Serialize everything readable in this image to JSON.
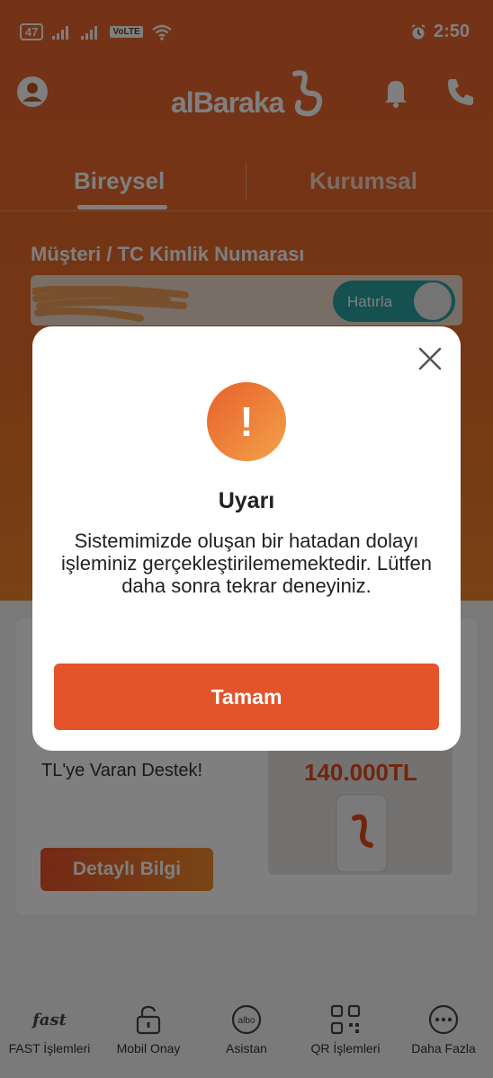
{
  "status_bar": {
    "battery": "47",
    "network_tag": "VoLTE",
    "time": "2:50"
  },
  "header": {
    "logo_text": "alBaraka",
    "icons": [
      "profile-icon",
      "bell-icon",
      "phone-icon"
    ]
  },
  "tabs": [
    {
      "label": "Bireysel",
      "active": true
    },
    {
      "label": "Kurumsal",
      "active": false
    }
  ],
  "login": {
    "field_label": "Müşteri / TC Kimlik Numarası",
    "remember_label": "Hatırla"
  },
  "promo": {
    "line1": "TL'ye Varan Destek!",
    "amount": "140.000TL",
    "button_label": "Detaylı Bilgi"
  },
  "bottom_nav": [
    {
      "label": "FAST İşlemleri",
      "icon": "fast-icon",
      "glyph": "fast"
    },
    {
      "label": "Mobil Onay",
      "icon": "unlock-icon"
    },
    {
      "label": "Asistan",
      "icon": "albo-icon",
      "glyph": "albo"
    },
    {
      "label": "QR İşlemleri",
      "icon": "qr-icon"
    },
    {
      "label": "Daha Fazla",
      "icon": "more-icon"
    }
  ],
  "dialog": {
    "title": "Uyarı",
    "message": "Sistemimizde oluşan bir hatadan dolayı işleminiz gerçekleştirilememektedir. Lütfen daha sonra tekrar deneyiniz.",
    "ok_label": "Tamam",
    "icon_glyph": "!"
  },
  "colors": {
    "brand_orange": "#e8642c",
    "button_orange": "#e3542a",
    "teal": "#2aa3a3"
  }
}
